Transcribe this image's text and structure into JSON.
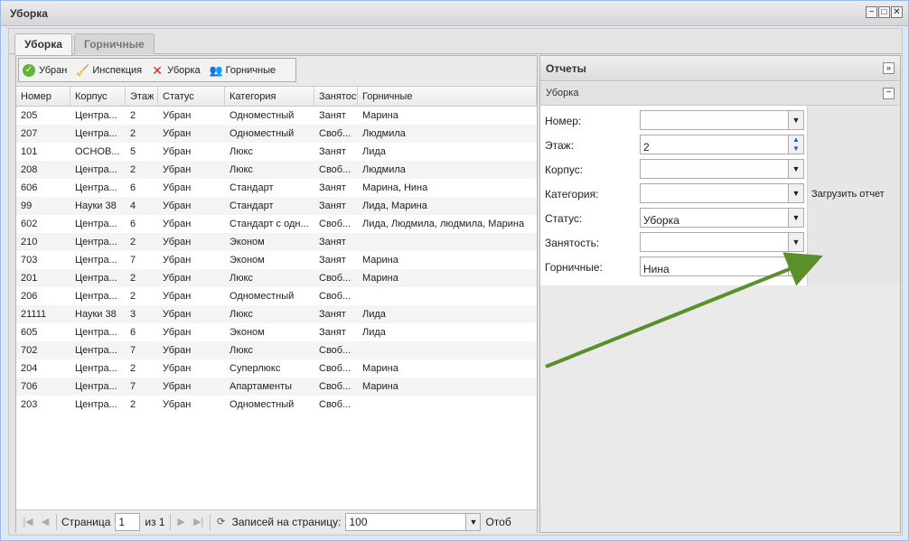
{
  "window": {
    "title": "Уборка",
    "tools": [
      "−",
      "□",
      "✕"
    ]
  },
  "tabs": [
    {
      "label": "Уборка",
      "active": true
    },
    {
      "label": "Горничные",
      "active": false
    }
  ],
  "toolbar": {
    "cleaned": "Убран",
    "inspection": "Инспекция",
    "cleaning": "Уборка",
    "maids": "Горничные"
  },
  "grid": {
    "columns": [
      "Номер",
      "Корпус",
      "Этаж",
      "Статус",
      "Категория",
      "Занятость",
      "Горничные"
    ],
    "rows": [
      [
        "205",
        "Центра...",
        "2",
        "Убран",
        "Одноместный",
        "Занят",
        "Марина"
      ],
      [
        "207",
        "Центра...",
        "2",
        "Убран",
        "Одноместный",
        "Своб...",
        "Людмила"
      ],
      [
        "101",
        "ОСНОВ...",
        "5",
        "Убран",
        "Люкс",
        "Занят",
        "Лида"
      ],
      [
        "208",
        "Центра...",
        "2",
        "Убран",
        "Люкс",
        "Своб...",
        "Людмила"
      ],
      [
        "606",
        "Центра...",
        "6",
        "Убран",
        "Стандарт",
        "Занят",
        "Марина, Нина"
      ],
      [
        "99",
        "Науки 38",
        "4",
        "Убран",
        "Стандарт",
        "Занят",
        "Лида, Марина"
      ],
      [
        "602",
        "Центра...",
        "6",
        "Убран",
        "Стандарт с одн...",
        "Своб...",
        "Лида, Людмила, людмила, Марина"
      ],
      [
        "210",
        "Центра...",
        "2",
        "Убран",
        "Эконом",
        "Занят",
        ""
      ],
      [
        "703",
        "Центра...",
        "7",
        "Убран",
        "Эконом",
        "Занят",
        "Марина"
      ],
      [
        "201",
        "Центра...",
        "2",
        "Убран",
        "Люкс",
        "Своб...",
        "Марина"
      ],
      [
        "206",
        "Центра...",
        "2",
        "Убран",
        "Одноместный",
        "Своб...",
        ""
      ],
      [
        "21111",
        "Науки 38",
        "3",
        "Убран",
        "Люкс",
        "Занят",
        "Лида"
      ],
      [
        "605",
        "Центра...",
        "6",
        "Убран",
        "Эконом",
        "Занят",
        "Лида"
      ],
      [
        "702",
        "Центра...",
        "7",
        "Убран",
        "Люкс",
        "Своб...",
        ""
      ],
      [
        "204",
        "Центра...",
        "2",
        "Убран",
        "Суперлюкс",
        "Своб...",
        "Марина"
      ],
      [
        "706",
        "Центра...",
        "7",
        "Убран",
        "Апартаменты",
        "Своб...",
        "Марина"
      ],
      [
        "203",
        "Центра...",
        "2",
        "Убран",
        "Одноместный",
        "Своб...",
        ""
      ]
    ]
  },
  "pager": {
    "page_label": "Страница",
    "page_value": "1",
    "of_label": "из 1",
    "per_page_label": "Записей на страницу:",
    "per_page_value": "100",
    "display_label": "Отоб"
  },
  "reports": {
    "title": "Отчеты",
    "section_title": "Уборка",
    "fields": [
      {
        "label": "Номер:",
        "value": "",
        "type": "combo"
      },
      {
        "label": "Этаж:",
        "value": "2",
        "type": "spinner"
      },
      {
        "label": "Корпус:",
        "value": "",
        "type": "combo"
      },
      {
        "label": "Категория:",
        "value": "",
        "type": "combo"
      },
      {
        "label": "Статус:",
        "value": "Уборка",
        "type": "combo"
      },
      {
        "label": "Занятость:",
        "value": "",
        "type": "combo"
      },
      {
        "label": "Горничные:",
        "value": "Нина",
        "type": "combo"
      }
    ],
    "load_button": "Загрузить отчет"
  },
  "colors": {
    "arrow": "#5b8f2a",
    "accent": "#99bbe8"
  }
}
